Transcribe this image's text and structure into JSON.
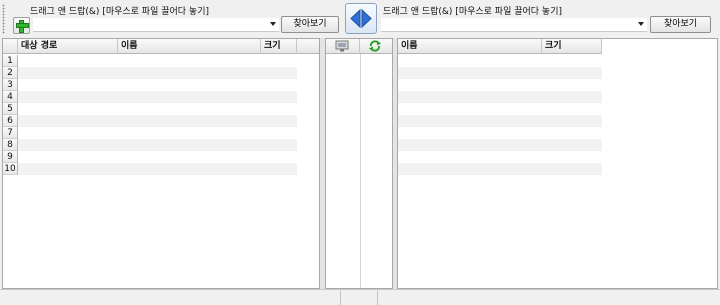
{
  "left_source": {
    "caption": "드래그 앤 드랍(&) [마우스로 파일 끌어다 놓기]",
    "combo_value": "",
    "browse_label": "찾아보기"
  },
  "right_source": {
    "caption": "드래그 앤 드랍(&) [마우스로 파일 끌어다 놓기]",
    "combo_value": "",
    "browse_label": "찾아보기"
  },
  "icons": {
    "add": "plus-icon",
    "swap": "swap-arrows-icon",
    "mid_left": "monitor-icon",
    "mid_right": "refresh-icon"
  },
  "left_grid": {
    "columns": [
      "대상 경로",
      "이름",
      "크기"
    ],
    "row_numbers": [
      "1",
      "2",
      "3",
      "4",
      "5",
      "6",
      "7",
      "8",
      "9",
      "10"
    ]
  },
  "right_grid": {
    "columns": [
      "이름",
      "크기"
    ],
    "row_count": 10
  },
  "status": {
    "cells": [
      "",
      "",
      ""
    ]
  },
  "colors": {
    "add_icon": "#2fb52f",
    "swap_arrow": "#2f6fd6",
    "refresh_icon": "#2aa12a"
  }
}
